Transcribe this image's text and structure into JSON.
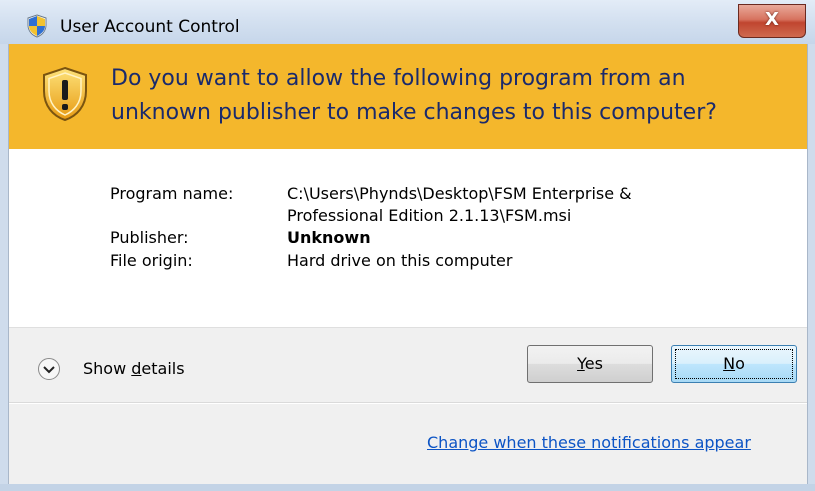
{
  "window": {
    "title": "User Account Control",
    "close_glyph": "X"
  },
  "banner": {
    "line1": "Do you want to allow the following program from an",
    "line2": "unknown publisher to make changes to this computer?",
    "icon": "shield-warning-icon"
  },
  "details": {
    "program_name_label": "Program name:",
    "program_name_line1": "C:\\Users\\Phynds\\Desktop\\FSM Enterprise &",
    "program_name_line2": "Professional Edition 2.1.13\\FSM.msi",
    "publisher_label": "Publisher:",
    "publisher_value": "Unknown",
    "file_origin_label": "File origin:",
    "file_origin_value": "Hard drive on this computer"
  },
  "footer": {
    "show_details_pre": "Show ",
    "show_details_mnemonic": "d",
    "show_details_post": "etails",
    "yes_mnemonic": "Y",
    "yes_rest": "es",
    "no_mnemonic": "N",
    "no_rest": "o",
    "link_text": "Change when these notifications appear"
  },
  "colors": {
    "banner": "#f4b72c",
    "banner_text": "#1a2a6c",
    "link": "#0c54c5",
    "close_button": "#c0452f"
  }
}
